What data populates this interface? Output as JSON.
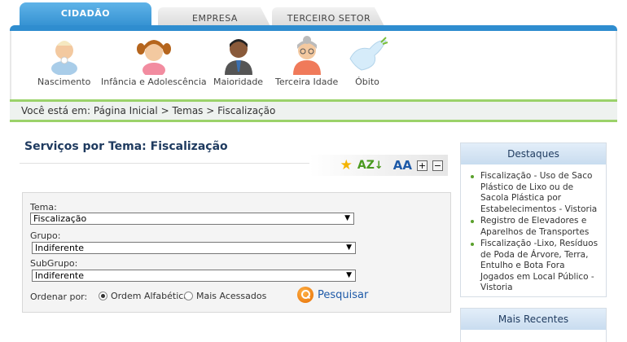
{
  "tabs": [
    {
      "label": "CIDADÃO",
      "active": true
    },
    {
      "label": "EMPRESA",
      "active": false
    },
    {
      "label": "TERCEIRO SETOR",
      "active": false
    }
  ],
  "life_stages": [
    {
      "label": "Nascimento",
      "icon": "baby-icon"
    },
    {
      "label": "Infância e Adolescência",
      "icon": "child-icon"
    },
    {
      "label": "Maioridade",
      "icon": "adult-icon"
    },
    {
      "label": "Terceira Idade",
      "icon": "elderly-icon"
    },
    {
      "label": "Óbito",
      "icon": "dove-icon"
    }
  ],
  "breadcrumb": {
    "prefix": "Você está em:",
    "items": [
      "Página Inicial",
      "Temas",
      "Fiscalização"
    ],
    "separator": ">"
  },
  "main": {
    "title": "Serviços por Tema: Fiscalização",
    "tools": {
      "az_label": "AZ",
      "font_label": "AA",
      "plus": "+",
      "minus": "−"
    }
  },
  "filters": {
    "tema_label": "Tema:",
    "tema_value": "Fiscalização",
    "grupo_label": "Grupo:",
    "grupo_value": "Indiferente",
    "subgrupo_label": "SubGrupo:",
    "subgrupo_value": "Indiferente",
    "order_label": "Ordenar por:",
    "order_options": [
      {
        "label": "Ordem Alfabética",
        "checked": true
      },
      {
        "label": "Mais Acessados",
        "checked": false
      }
    ],
    "search_label": "Pesquisar"
  },
  "sidebar": {
    "destaques": {
      "title": "Destaques",
      "items": [
        "Fiscalização - Uso de Saco Plástico de Lixo ou de Sacola Plástica por Estabelecimentos - Vistoria",
        "Registro de Elevadores e Aparelhos de Transportes",
        "Fiscalização -Lixo, Resíduos de Poda de Árvore, Terra, Entulho e Bota Fora Jogados em Local Público - Vistoria"
      ]
    },
    "recentes": {
      "title": "Mais Recentes"
    }
  },
  "colors": {
    "primary_blue": "#2f8dcf",
    "breadcrumb_green": "#9bd26a",
    "title_navy": "#1e3a5f",
    "link_blue": "#1e5aa8",
    "star_gold": "#f4b400",
    "az_green": "#4a9a1f"
  }
}
